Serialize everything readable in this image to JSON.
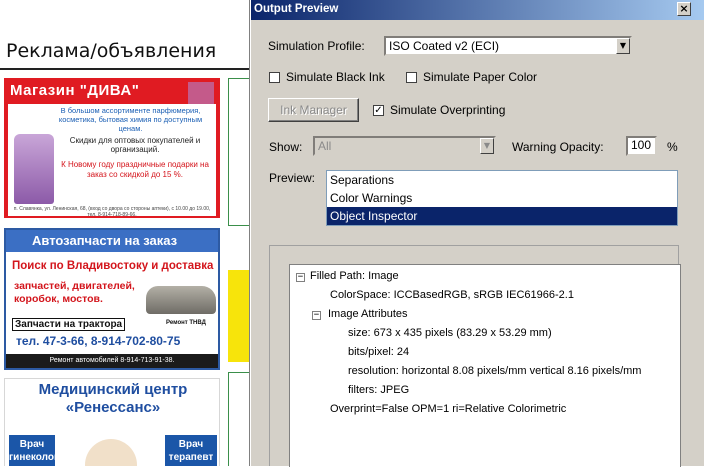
{
  "document": {
    "title": "Реклама/объявления",
    "ad1": {
      "header": "Магазин \"ДИВА\"",
      "line1": "В большом ассортименте парфюмерия, косметика, бытовая химия по доступным ценам.",
      "line2": "Скидки для оптовых покупателей и организаций.",
      "line3": "К Новому году праздничные подарки на заказ со скидкой до 15 %.",
      "address": "п. Славянка, ул. Ленинская, 68, (вход со двора со стороны аптеки), с 10.00 до 19.00, тел. 8-914-718-89-66."
    },
    "ad2": {
      "header": "Автозапчасти на заказ",
      "line1": "Поиск по Владивостоку и доставка",
      "line2": "запчастей, двигателей, коробок, мостов.",
      "line3": "Запчасти на трактора",
      "line4": "Ремонт ТНВД",
      "phone": "тел. 47-3-66, 8-914-702-80-75",
      "footer": "Ремонт автомобилей 8-914-713-91-38."
    },
    "ad3": {
      "line1": "Медицинский центр",
      "line2": "«Ренессанс»",
      "left_box": "Врач гинеколог",
      "right_box": "Врач терапевт"
    }
  },
  "dialog": {
    "title": "Output Preview",
    "close_glyph": "×",
    "simulation_profile_label": "Simulation Profile:",
    "simulation_profile_value": "ISO Coated v2 (ECI)",
    "simulate_black_ink_label": "Simulate Black Ink",
    "simulate_black_ink_checked": false,
    "simulate_paper_color_label": "Simulate Paper Color",
    "simulate_paper_color_checked": false,
    "ink_manager_label": "Ink Manager",
    "simulate_overprinting_label": "Simulate Overprinting",
    "simulate_overprinting_checked": true,
    "check_glyph": "✓",
    "show_label": "Show:",
    "show_value": "All",
    "warning_opacity_label": "Warning Opacity:",
    "warning_opacity_value": "100",
    "percent_label": "%",
    "preview_label": "Preview:",
    "preview_options": [
      "Separations",
      "Color Warnings",
      "Object Inspector"
    ],
    "preview_selected": "Object Inspector",
    "dropdown_glyph": "▼",
    "tree": {
      "root": "Filled Path: Image",
      "root_toggle": "−",
      "colorspace": "ColorSpace: ICCBasedRGB, sRGB IEC61966-2.1",
      "image_attributes": "Image Attributes",
      "image_attributes_toggle": "−",
      "size": "size: 673 x 435 pixels (83.29 x 53.29 mm)",
      "bits": "bits/pixel: 24",
      "resolution": "resolution: horizontal 8.08 pixels/mm vertical 8.16 pixels/mm",
      "filters": "filters: JPEG",
      "overprint": "Overprint=False OPM=1 ri=Relative Colorimetric"
    }
  }
}
